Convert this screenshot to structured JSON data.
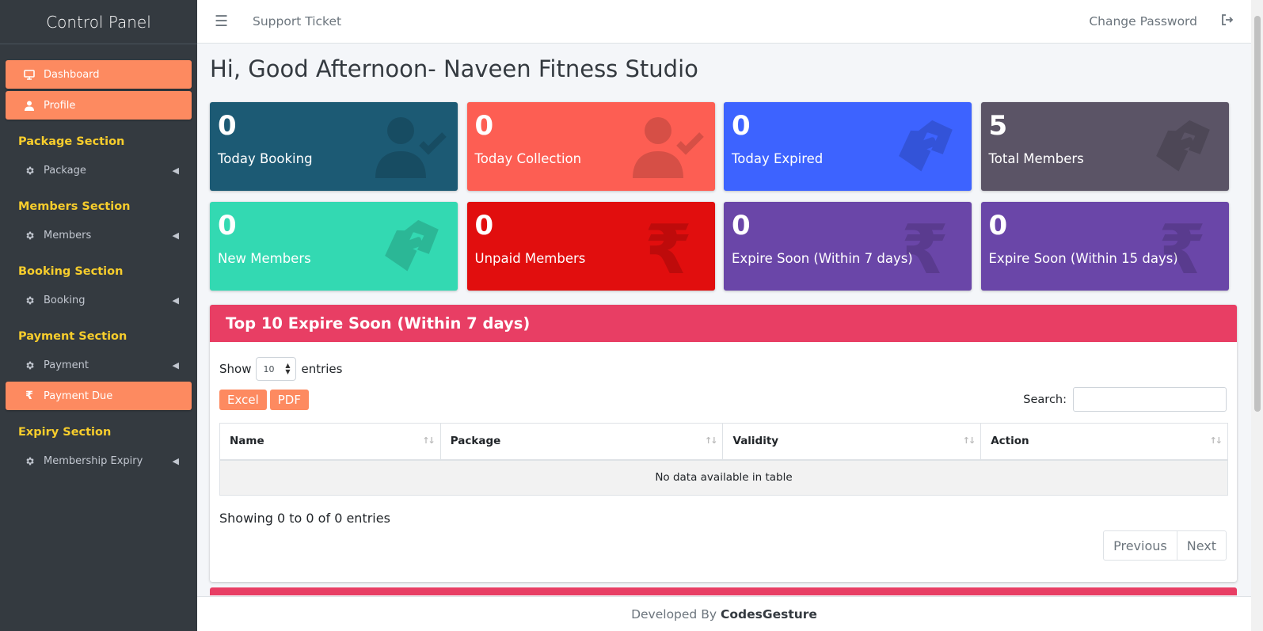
{
  "sidebar": {
    "brand": "Control Panel",
    "items": [
      {
        "type": "active",
        "label": "Dashboard",
        "icon": "desktop-icon"
      },
      {
        "type": "active",
        "label": "Profile",
        "icon": "user-icon"
      },
      {
        "type": "section",
        "label": "Package Section"
      },
      {
        "type": "item",
        "label": "Package",
        "icon": "gear-icon"
      },
      {
        "type": "section",
        "label": "Members Section"
      },
      {
        "type": "item",
        "label": "Members",
        "icon": "gear-icon"
      },
      {
        "type": "section",
        "label": "Booking Section"
      },
      {
        "type": "item",
        "label": "Booking",
        "icon": "gear-icon"
      },
      {
        "type": "section",
        "label": "Payment Section"
      },
      {
        "type": "item",
        "label": "Payment",
        "icon": "gear-icon"
      },
      {
        "type": "active",
        "label": "Payment Due",
        "icon": "rupee-icon"
      },
      {
        "type": "section",
        "label": "Expiry Section"
      },
      {
        "type": "item",
        "label": "Membership Expiry",
        "icon": "gear-icon"
      }
    ]
  },
  "topbar": {
    "support_label": "Support Ticket",
    "change_password_label": "Change Password"
  },
  "greeting": "Hi, Good Afternoon- Naveen Fitness Studio",
  "stats": [
    {
      "value": "0",
      "label": "Today Booking",
      "color": "#1c5a74",
      "icon": "user-check-icon"
    },
    {
      "value": "0",
      "label": "Today Collection",
      "color": "#fd5e53",
      "icon": "user-check-icon"
    },
    {
      "value": "0",
      "label": "Today Expired",
      "color": "#3d63ff",
      "icon": "handshake-icon"
    },
    {
      "value": "5",
      "label": "Total Members",
      "color": "#5b5466",
      "icon": "handshake-icon"
    },
    {
      "value": "0",
      "label": "New Members",
      "color": "#33d9b2",
      "icon": "handshake-icon"
    },
    {
      "value": "0",
      "label": "Unpaid Members",
      "color": "#e10e0e",
      "icon": "rupee-icon"
    },
    {
      "value": "0",
      "label": "Expire Soon (Within 7 days)",
      "color": "#6a46a8",
      "icon": "rupee-icon"
    },
    {
      "value": "0",
      "label": "Expire Soon (Within 15 days)",
      "color": "#6a46a8",
      "icon": "rupee-icon"
    }
  ],
  "table_card": {
    "title": "Top 10 Expire Soon (Within 7 days)",
    "show_label": "Show",
    "page_length": "10",
    "entries_label": "entries",
    "excel_label": "Excel",
    "pdf_label": "PDF",
    "search_label": "Search:",
    "columns": [
      "Name",
      "Package",
      "Validity",
      "Action"
    ],
    "empty_message": "No data available in table",
    "info": "Showing 0 to 0 of 0 entries",
    "previous_label": "Previous",
    "next_label": "Next"
  },
  "footer": {
    "prefix": "Developed By",
    "brand": "CodesGesture"
  }
}
